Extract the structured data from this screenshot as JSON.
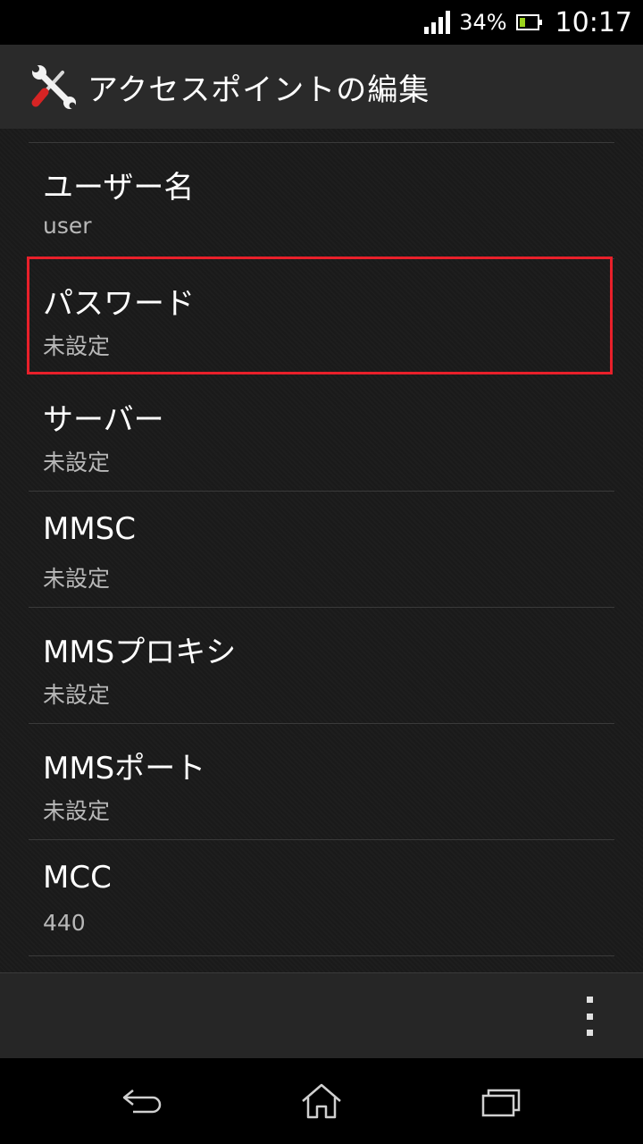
{
  "status_bar": {
    "battery_percent": "34%",
    "time": "10:17",
    "icons": [
      "signal-icon",
      "battery-icon"
    ]
  },
  "action_bar": {
    "icon": "tools-icon",
    "title": "アクセスポイントの編集"
  },
  "preferences": [
    {
      "title": "ユーザー名",
      "summary": "user"
    },
    {
      "title": "パスワード",
      "summary": "未設定"
    },
    {
      "title": "サーバー",
      "summary": "未設定"
    },
    {
      "title": "MMSC",
      "summary": "未設定"
    },
    {
      "title": "MMSプロキシ",
      "summary": "未設定"
    },
    {
      "title": "MMSポート",
      "summary": "未設定"
    },
    {
      "title": "MCC",
      "summary": "440"
    }
  ],
  "highlight": {
    "color": "#e8202a",
    "target": "パスワード"
  },
  "menu_bar": {
    "icon": "overflow-menu-icon"
  },
  "nav_bar": {
    "icons": [
      "back-icon",
      "home-icon",
      "recent-apps-icon"
    ]
  }
}
